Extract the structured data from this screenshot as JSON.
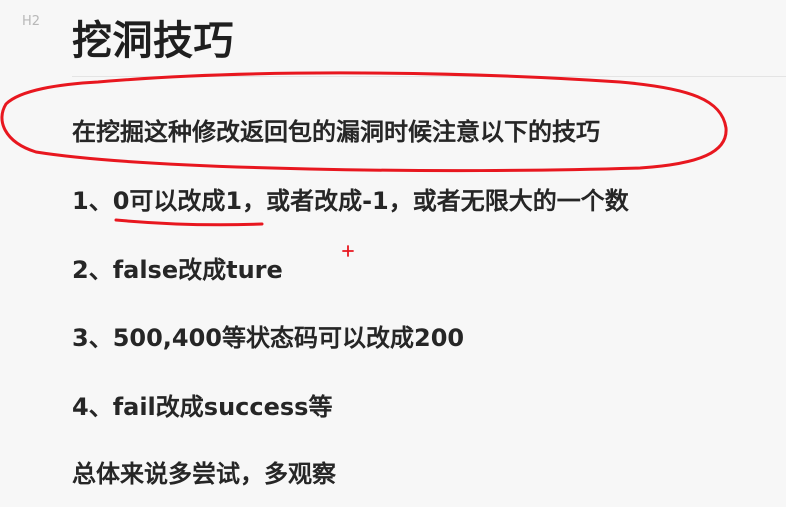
{
  "heading": {
    "level_marker": "H2",
    "title": "挖洞技巧"
  },
  "content": {
    "intro": "在挖掘这种修改返回包的漏洞时候注意以下的技巧",
    "tips": [
      "1、0可以改成1，或者改成-1，或者无限大的一个数",
      "2、false改成ture",
      "3、500,400等状态码可以改成200",
      "4、fail改成success等"
    ],
    "summary": "总体来说多尝试，多观察"
  },
  "colors": {
    "annotation_red": "#e8171f",
    "text": "#262626",
    "background": "#f7f7f7"
  }
}
